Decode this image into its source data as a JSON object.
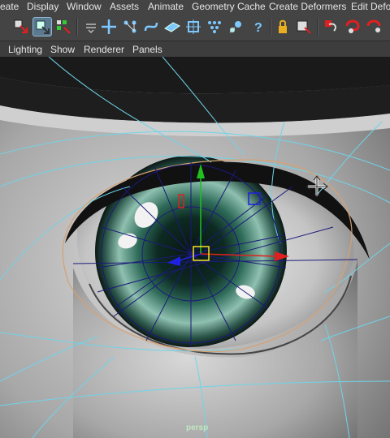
{
  "menubar": {
    "items": [
      "eate",
      "Display",
      "Window",
      "Assets",
      "Animate",
      "Geometry Cache",
      "Create Deformers",
      "Edit Defor"
    ]
  },
  "panel_menu": {
    "items": [
      "Lighting",
      "Show",
      "Renderer",
      "Panels"
    ]
  },
  "viewport": {
    "camera_label": "persp"
  },
  "colors": {
    "ui_bg": "#444444",
    "text": "#e6e6e6",
    "highlight": "#5b7a8f",
    "wire_cyan": "#6fd4e8",
    "wire_blue": "#1a1a7a",
    "selection_orange": "#d9a070",
    "manip_x": "#e02020",
    "manip_y": "#20c020",
    "manip_z": "#2020e0",
    "camera_label": "#bfe8c0"
  },
  "toolbar_icons": [
    "select-by-hierarchy-icon",
    "select-by-object-icon",
    "select-by-component-icon",
    "snap-menu-icon",
    "snap-to-grid-icon",
    "snap-to-curve-icon",
    "snap-to-point-icon",
    "snap-to-view-plane-icon",
    "make-live-icon",
    "history-icon",
    "construction-icon",
    "lock-icon",
    "render-region-icon",
    "render-current-icon",
    "ipr-render-icon",
    "render-settings-icon"
  ],
  "panel_icons": [
    "camera-attr-icon",
    "bookmark-icon",
    "image-plane-icon",
    "grid-icon",
    "shaded-wire-icon",
    "smooth-shade-icon",
    "flat-shade-icon",
    "bounding-box-icon",
    "textured-icon",
    "use-lights-icon",
    "shadows-icon",
    "ambient-occlusion-icon",
    "isolate-select-icon",
    "xray-icon",
    "xray-joints-icon",
    "xray-active-icon",
    "hud-icon"
  ]
}
